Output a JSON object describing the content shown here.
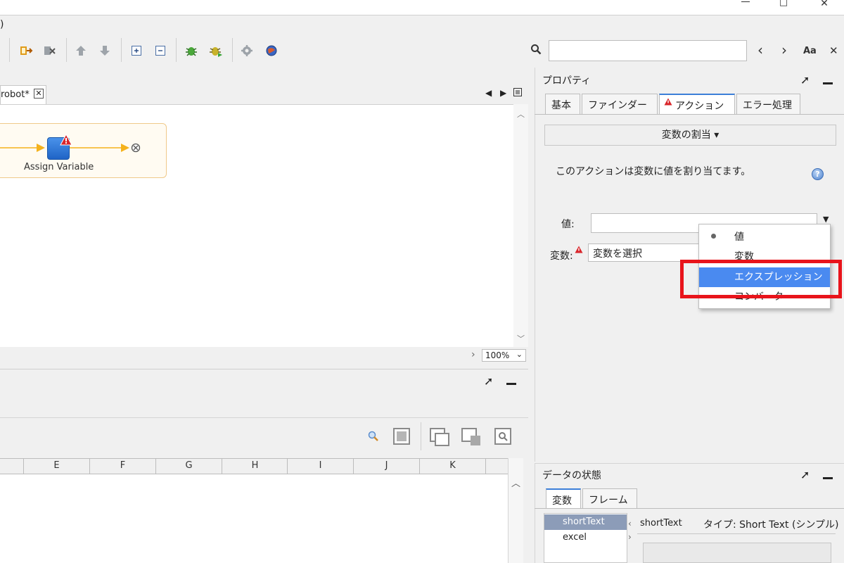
{
  "window": {
    "maximize_glyph": "□",
    "close_glyph": "✕",
    "fragment_glyph": ")"
  },
  "search": {
    "placeholder": "",
    "value": "",
    "prev": "‹",
    "next": "›",
    "case_label": "Aa",
    "close": "✕"
  },
  "editor": {
    "tab_label": "robot*",
    "tab_close": "✕",
    "node_label": "Assign Variable",
    "zoom": "100%"
  },
  "bottom": {
    "columns": [
      "E",
      "F",
      "G",
      "H",
      "I",
      "J",
      "K"
    ]
  },
  "properties": {
    "title": "プロパティ",
    "tabs": [
      "基本",
      "ファインダー",
      "アクション",
      "エラー処理"
    ],
    "active_tab_index": 2,
    "assign_button": "変数の割当 ▾",
    "description": "このアクションは変数に値を割り当てます。",
    "value_label": "値:",
    "variable_label": "変数:",
    "variable_select": "変数を選択",
    "dropdown_items": [
      "値",
      "変数",
      "エクスプレッション",
      "コンバータ"
    ],
    "dropdown_selected": "エクスプレッション"
  },
  "data_state": {
    "title": "データの状態",
    "tabs": [
      "変数",
      "フレーム"
    ],
    "variables": [
      "shortText",
      "excel"
    ],
    "selected_variable": "shortText",
    "detail_name": "shortText",
    "detail_type": "タイプ: Short Text (シンプル)"
  },
  "colors": {
    "accent": "#4a8af0",
    "highlight": "#e8141b",
    "flow_line": "#f5b21c",
    "node": "#2f7bd9",
    "warning": "#d9252a"
  }
}
